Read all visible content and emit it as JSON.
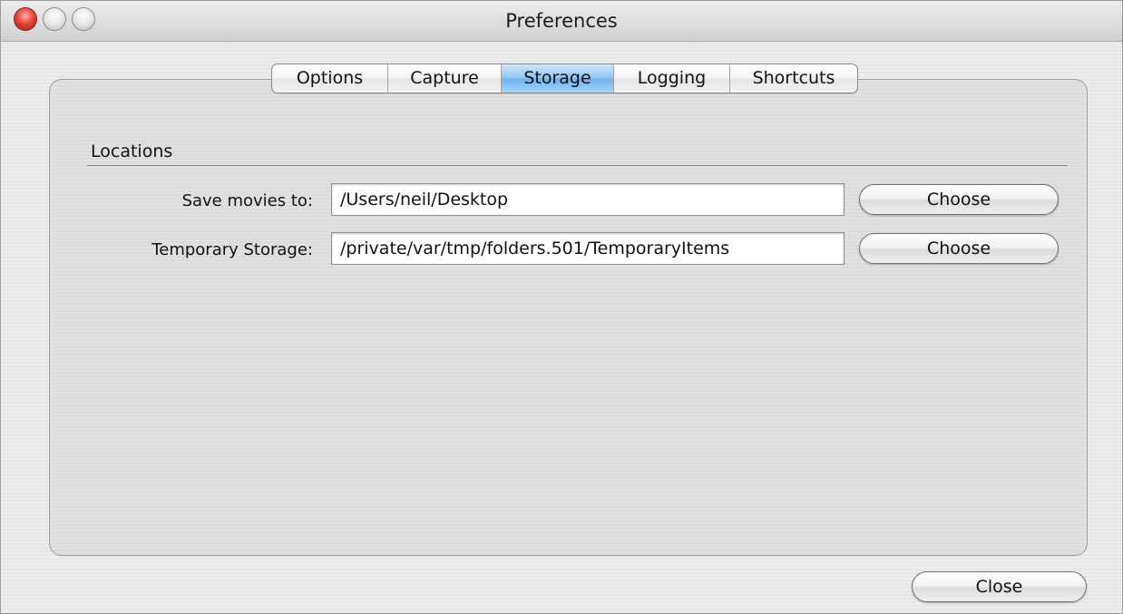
{
  "window": {
    "title": "Preferences"
  },
  "tabs": [
    {
      "label": "Options",
      "active": false
    },
    {
      "label": "Capture",
      "active": false
    },
    {
      "label": "Storage",
      "active": true
    },
    {
      "label": "Logging",
      "active": false
    },
    {
      "label": "Shortcuts",
      "active": false
    }
  ],
  "locations": {
    "section_title": "Locations",
    "rows": [
      {
        "label": "Save movies to:",
        "value": "/Users/neil/Desktop",
        "button": "Choose"
      },
      {
        "label": "Temporary Storage:",
        "value": "/private/var/tmp/folders.501/TemporaryItems",
        "button": "Choose"
      }
    ]
  },
  "footer": {
    "close_label": "Close"
  },
  "colors": {
    "accent_tab": "#8ec3f3",
    "close_light": "#e8453a"
  }
}
